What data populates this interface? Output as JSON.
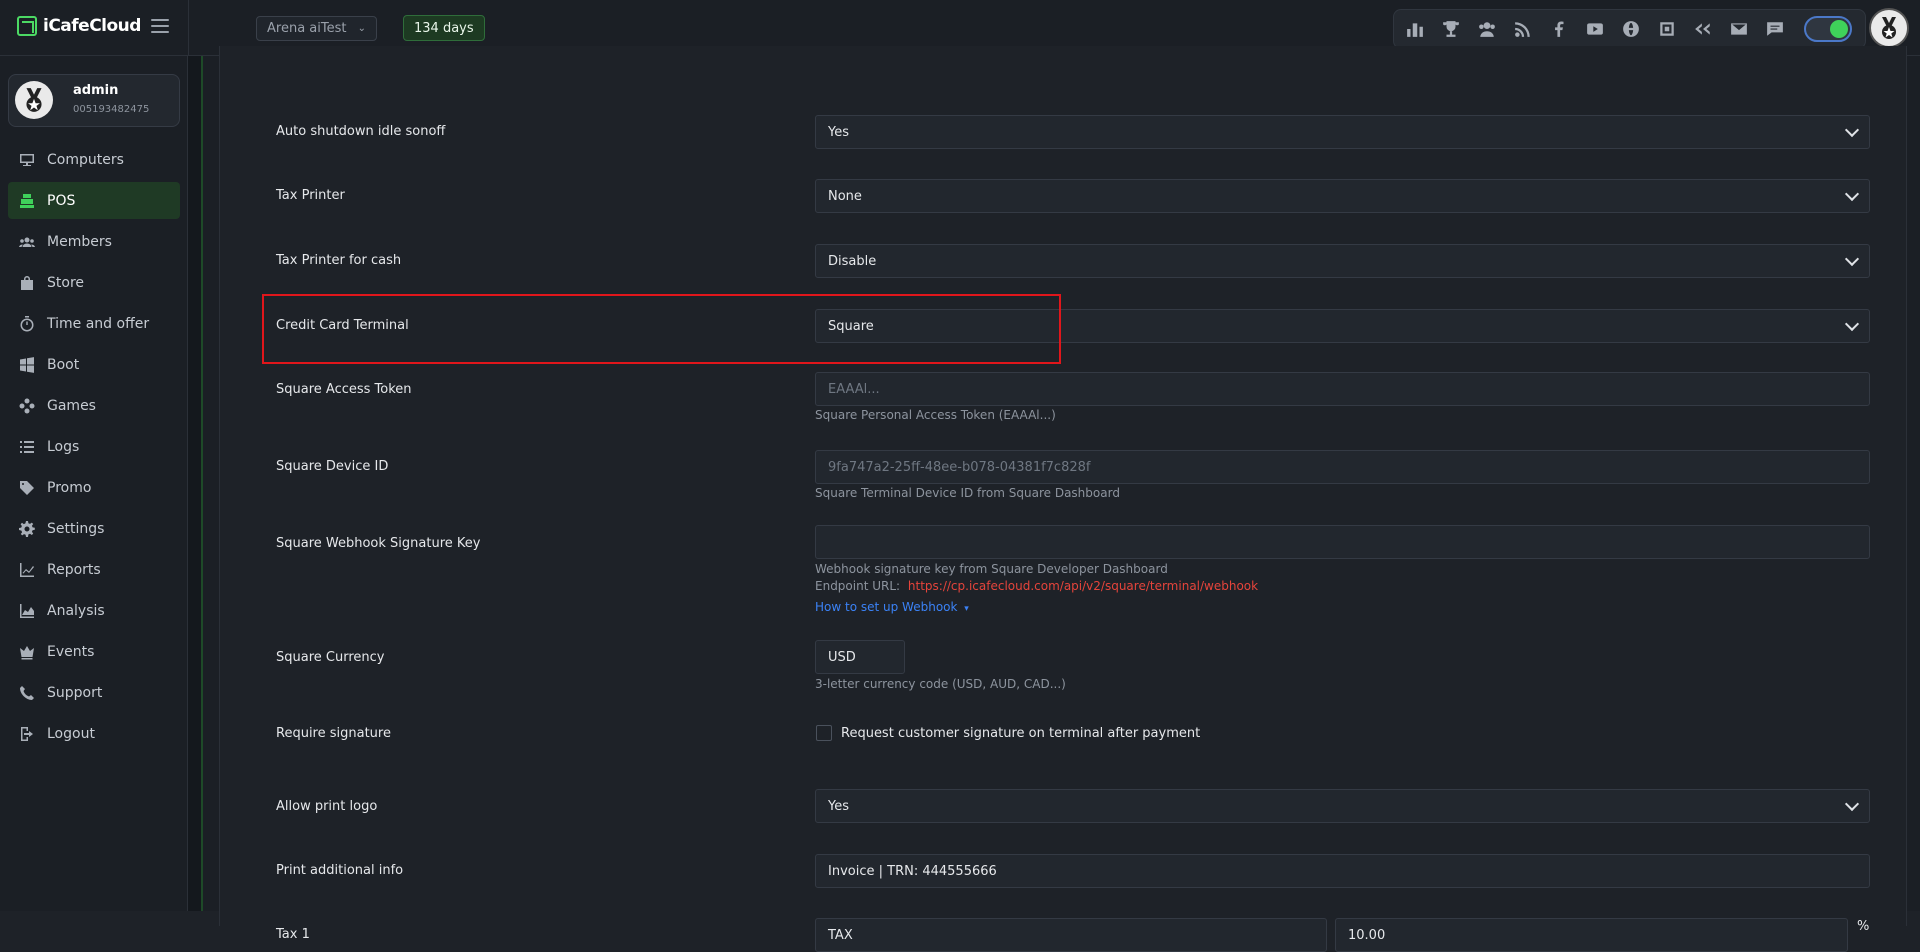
{
  "topbar": {
    "logo_text": "iCafeCloud",
    "branch": "Arena aiTest",
    "days_badge": "134 days",
    "icons": [
      "leaderboard-icon",
      "trophy-icon",
      "group-icon",
      "rss-icon",
      "facebook-icon",
      "youtube-icon",
      "globe-icon",
      "icafe-icon",
      "double-chevron-icon",
      "mail-icon",
      "chat-icon"
    ]
  },
  "user": {
    "name": "admin",
    "id": "005193482475"
  },
  "nav": {
    "items": [
      {
        "label": "Computers",
        "icon": "monitor-icon"
      },
      {
        "label": "POS",
        "icon": "register-icon"
      },
      {
        "label": "Members",
        "icon": "members-icon"
      },
      {
        "label": "Store",
        "icon": "bag-icon"
      },
      {
        "label": "Time and offer",
        "icon": "stopwatch-icon"
      },
      {
        "label": "Boot",
        "icon": "windows-icon"
      },
      {
        "label": "Games",
        "icon": "gamepad-icon"
      },
      {
        "label": "Logs",
        "icon": "list-icon"
      },
      {
        "label": "Promo",
        "icon": "tag-icon"
      },
      {
        "label": "Settings",
        "icon": "gear-icon"
      },
      {
        "label": "Reports",
        "icon": "line-chart-icon"
      },
      {
        "label": "Analysis",
        "icon": "area-chart-icon"
      },
      {
        "label": "Events",
        "icon": "crown-icon"
      },
      {
        "label": "Support",
        "icon": "phone-icon"
      },
      {
        "label": "Logout",
        "icon": "logout-icon"
      }
    ],
    "active": "POS"
  },
  "form": {
    "auto_shutdown": {
      "label": "Auto shutdown idle sonoff",
      "value": "Yes"
    },
    "tax_printer": {
      "label": "Tax Printer",
      "value": "None"
    },
    "tax_printer_cash": {
      "label": "Tax Printer for cash",
      "value": "Disable"
    },
    "credit_card_terminal": {
      "label": "Credit Card Terminal",
      "value": "Square"
    },
    "square_access_token": {
      "label": "Square Access Token",
      "placeholder": "EAAAl...",
      "help": "Square Personal Access Token (EAAAl...)"
    },
    "square_device_id": {
      "label": "Square Device ID",
      "placeholder": "9fa747a2-25ff-48ee-b078-04381f7c828f",
      "help": "Square Terminal Device ID from Square Dashboard"
    },
    "square_webhook": {
      "label": "Square Webhook Signature Key",
      "help": "Webhook signature key from Square Developer Dashboard",
      "endpoint_label": "Endpoint URL:",
      "endpoint_url": "https://cp.icafecloud.com/api/v2/square/terminal/webhook",
      "howto": "How to set up Webhook"
    },
    "square_currency": {
      "label": "Square Currency",
      "value": "USD",
      "help": "3-letter currency code (USD, AUD, CAD...)"
    },
    "require_signature": {
      "label": "Require signature",
      "checkbox_label": "Request customer signature on terminal after payment",
      "checked": false
    },
    "allow_print_logo": {
      "label": "Allow print logo",
      "value": "Yes"
    },
    "print_additional_info": {
      "label": "Print additional info",
      "value": "Invoice | TRN: 444555666"
    },
    "tax1": {
      "label": "Tax 1",
      "name": "TAX",
      "rate": "10.00",
      "unit": "%"
    }
  }
}
